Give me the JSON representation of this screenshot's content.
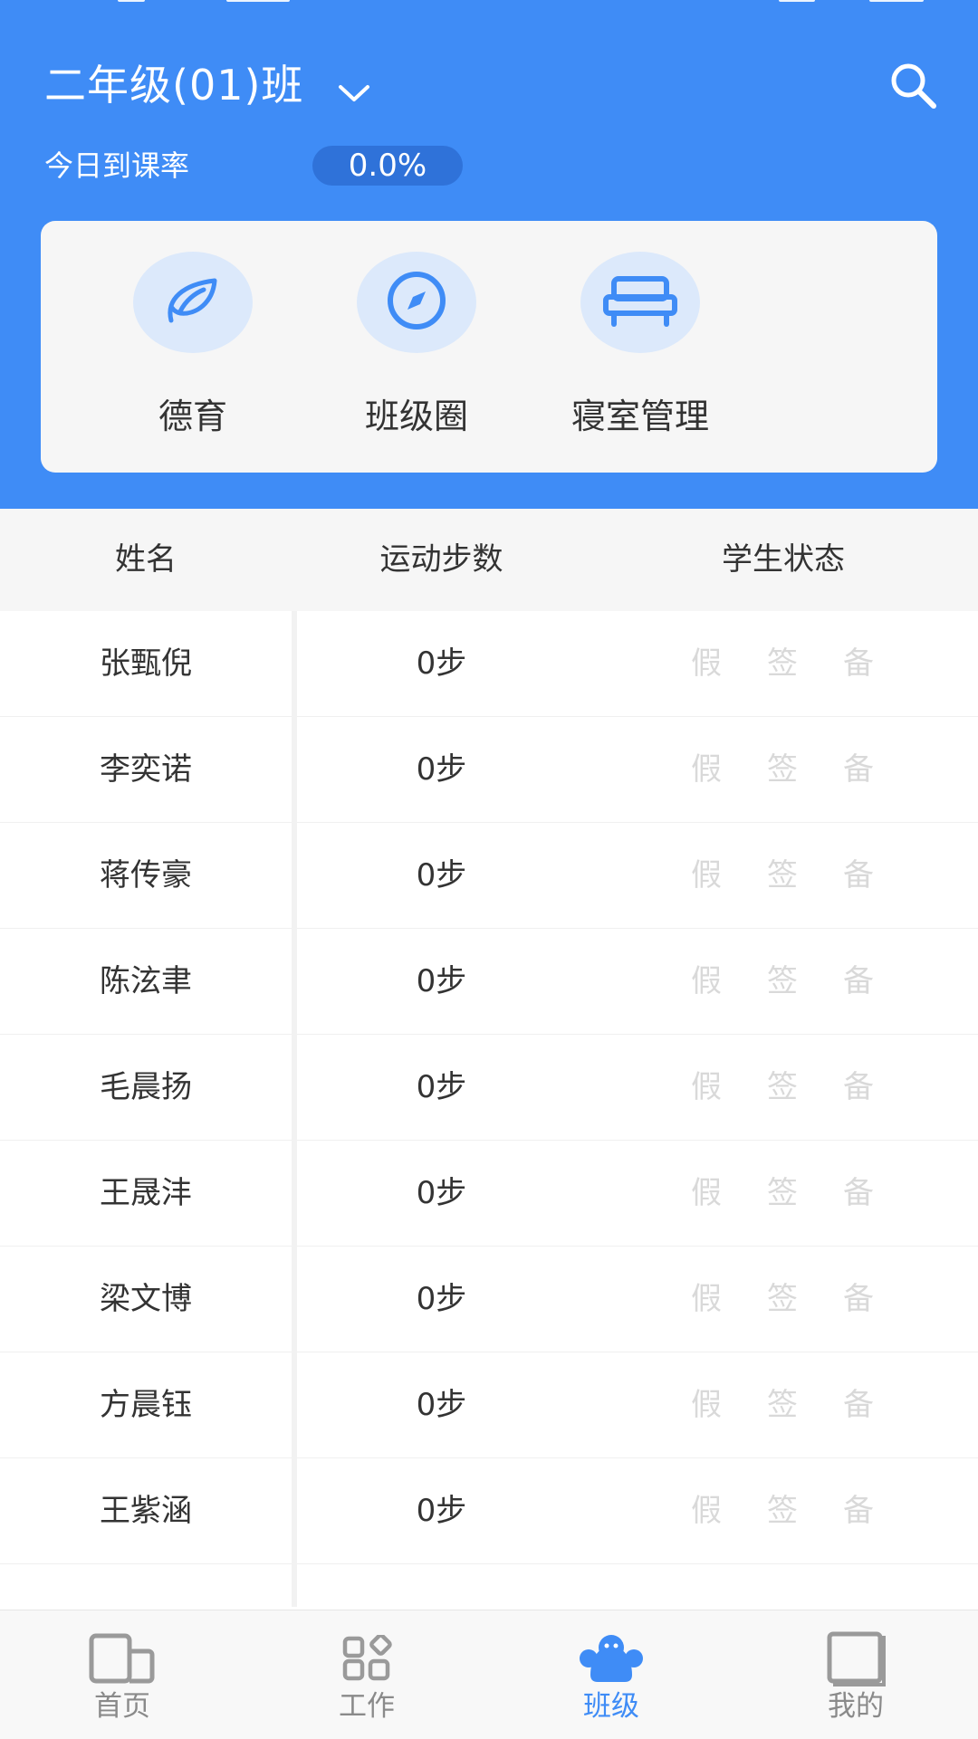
{
  "header": {
    "class_name": "二年级(01)班",
    "attendance_label": "今日到课率",
    "attendance_rate": "0.0%"
  },
  "shortcuts": [
    {
      "label": "德育",
      "icon": "leaf-icon"
    },
    {
      "label": "班级圈",
      "icon": "compass-icon"
    },
    {
      "label": "寝室管理",
      "icon": "bed-icon"
    }
  ],
  "table": {
    "columns": [
      "姓名",
      "运动步数",
      "学生状态"
    ],
    "status_labels": [
      "假",
      "签",
      "备"
    ],
    "rows": [
      {
        "name": "张甄倪",
        "steps": "0步"
      },
      {
        "name": "李奕诺",
        "steps": "0步"
      },
      {
        "name": "蒋传豪",
        "steps": "0步"
      },
      {
        "name": "陈泫聿",
        "steps": "0步"
      },
      {
        "name": "毛晨扬",
        "steps": "0步"
      },
      {
        "name": "王晟沣",
        "steps": "0步"
      },
      {
        "name": "梁文博",
        "steps": "0步"
      },
      {
        "name": "方晨钰",
        "steps": "0步"
      },
      {
        "name": "王紫涵",
        "steps": "0步"
      }
    ]
  },
  "tabbar": {
    "items": [
      {
        "label": "首页",
        "icon": "home-icon"
      },
      {
        "label": "工作",
        "icon": "apps-icon"
      },
      {
        "label": "班级",
        "icon": "class-group-icon"
      },
      {
        "label": "我的",
        "icon": "profile-book-icon"
      }
    ],
    "active_index": 2
  },
  "colors": {
    "primary": "#3f8cf6",
    "badge": "#2f72d9",
    "icon_bg": "#dce9fb",
    "status_disabled": "#d9d9d9"
  }
}
